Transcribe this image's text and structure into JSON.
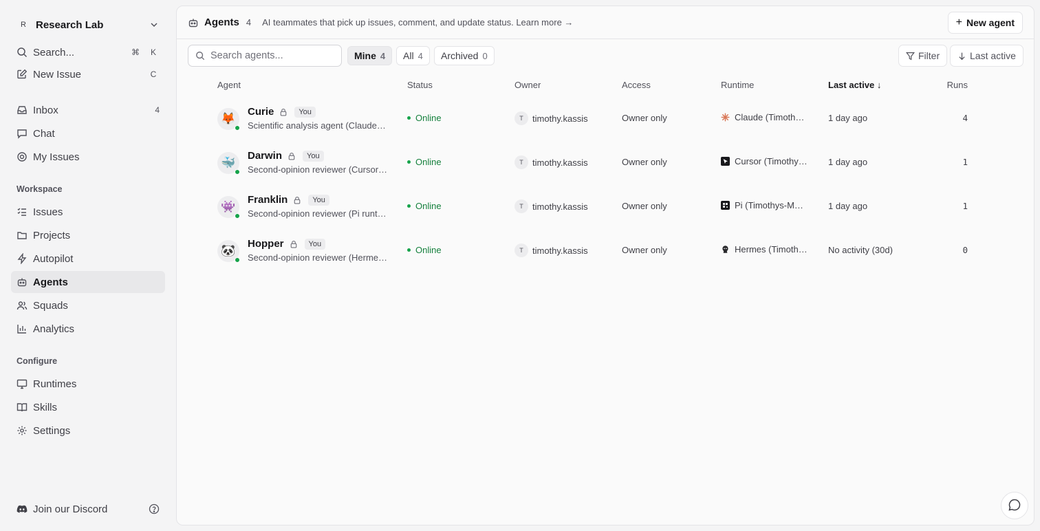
{
  "workspace": {
    "badge": "R",
    "name": "Research Lab"
  },
  "sidebar": {
    "search": {
      "label": "Search...",
      "shortcut_mod": "⌘",
      "shortcut_key": "K"
    },
    "new_issue": {
      "label": "New Issue",
      "shortcut": "C"
    },
    "inbox": {
      "label": "Inbox",
      "count": "4"
    },
    "chat": {
      "label": "Chat"
    },
    "my_issues": {
      "label": "My Issues"
    },
    "workspace_section": "Workspace",
    "workspace_items": [
      {
        "label": "Issues",
        "icon": "list-icon"
      },
      {
        "label": "Projects",
        "icon": "folder-icon"
      },
      {
        "label": "Autopilot",
        "icon": "zap-icon"
      },
      {
        "label": "Agents",
        "icon": "bot-icon"
      },
      {
        "label": "Squads",
        "icon": "users-icon"
      },
      {
        "label": "Analytics",
        "icon": "chart-icon"
      }
    ],
    "configure_section": "Configure",
    "configure_items": [
      {
        "label": "Runtimes",
        "icon": "monitor-icon"
      },
      {
        "label": "Skills",
        "icon": "book-icon"
      },
      {
        "label": "Settings",
        "icon": "gear-icon"
      }
    ],
    "discord": {
      "label": "Join our Discord"
    }
  },
  "header": {
    "title": "Agents",
    "count": "4",
    "description": "AI teammates that pick up issues, comment, and update status. Learn more →",
    "new_agent_label": "New agent"
  },
  "toolbar": {
    "search_placeholder": "Search agents...",
    "filters": [
      {
        "label": "Mine",
        "count": "4",
        "selected": true
      },
      {
        "label": "All",
        "count": "4",
        "selected": false
      },
      {
        "label": "Archived",
        "count": "0",
        "selected": false
      }
    ],
    "filter_label": "Filter",
    "sort_label": "Last active"
  },
  "table": {
    "columns": {
      "agent": "Agent",
      "status": "Status",
      "owner": "Owner",
      "access": "Access",
      "runtime": "Runtime",
      "last_active": "Last active ↓",
      "runs": "Runs"
    },
    "rows": [
      {
        "emoji": "🦊",
        "name": "Curie",
        "you": "You",
        "description": "Scientific analysis agent (Claude Code runtime)",
        "status": "Online",
        "owner_initial": "T",
        "owner": "timothy.kassis",
        "access": "Owner only",
        "runtime_icon": "claude-icon",
        "runtime": "Claude (Timothys-MacBook)",
        "last_active": "1 day ago",
        "runs": "4"
      },
      {
        "emoji": "🐳",
        "name": "Darwin",
        "you": "You",
        "description": "Second-opinion reviewer (Cursor runtime)",
        "status": "Online",
        "owner_initial": "T",
        "owner": "timothy.kassis",
        "access": "Owner only",
        "runtime_icon": "cursor-icon",
        "runtime": "Cursor (Timothys-MacBook)",
        "last_active": "1 day ago",
        "runs": "1"
      },
      {
        "emoji": "👾",
        "name": "Franklin",
        "you": "You",
        "description": "Second-opinion reviewer (Pi runtime)",
        "status": "Online",
        "owner_initial": "T",
        "owner": "timothy.kassis",
        "access": "Owner only",
        "runtime_icon": "pi-icon",
        "runtime": "Pi (Timothys-MacBook)",
        "last_active": "1 day ago",
        "runs": "1"
      },
      {
        "emoji": "🐼",
        "name": "Hopper",
        "you": "You",
        "description": "Second-opinion reviewer (Hermes runtime)",
        "status": "Online",
        "owner_initial": "T",
        "owner": "timothy.kassis",
        "access": "Owner only",
        "runtime_icon": "hermes-icon",
        "runtime": "Hermes (Timothys-MacBook)",
        "last_active": "No activity (30d)",
        "runs": "0"
      }
    ]
  },
  "colors": {
    "online": "#16a34a",
    "active_nav_bg": "#e8e8ea",
    "claude": "#d97757"
  }
}
